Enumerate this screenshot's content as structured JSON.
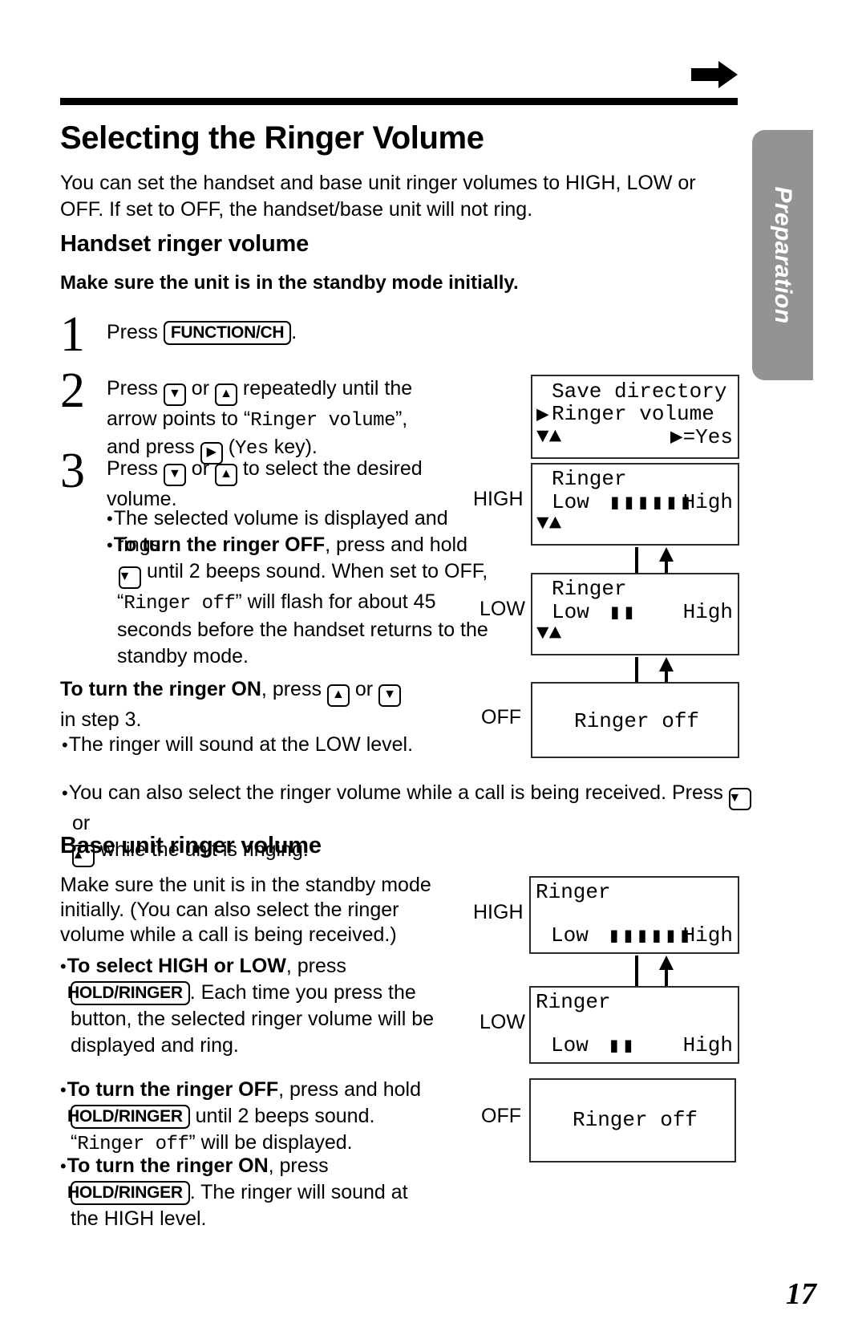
{
  "page": {
    "number": "17",
    "side_tab": "Preparation"
  },
  "header": {
    "arrow_icon": "right-arrow-icon"
  },
  "title": "Selecting the Ringer Volume",
  "intro": "You can set the handset and base unit ringer volumes to HIGH, LOW or OFF. If set to OFF, the handset/base unit will not ring.",
  "handset": {
    "heading": "Handset ringer volume",
    "precondition": "Make sure the unit is in the standby mode initially.",
    "steps": [
      {
        "num": "1",
        "pre": "Press ",
        "key": "FUNCTION/CH",
        "post": "."
      },
      {
        "num": "2",
        "l1a": "Press ",
        "k_down": "▼",
        "l1b": " or ",
        "k_up": "▲",
        "l1c": " repeatedly until the",
        "l2a": "arrow points to “",
        "l2_mono": "Ringer volume",
        "l2b": "”,",
        "l3a": "and press ",
        "k_right": "▶",
        "l3b": " (",
        "l3_mono": "Yes",
        "l3c": " key)."
      },
      {
        "num": "3",
        "l1a": "Press ",
        "k_down": "▼",
        "l1b": " or ",
        "k_up": "▲",
        "l1c": " to select the desired",
        "l2": "volume."
      }
    ],
    "bullets": [
      {
        "text": "The selected volume is displayed and rings."
      },
      {
        "bold": "To turn the ringer OFF",
        "rest1": ", press and hold",
        "key": "▼",
        "rest2": " until 2 beeps sound. When set to OFF,",
        "quote_open": "“",
        "mono": "Ringer off",
        "quote_close": "”",
        "rest3": " will flash for about 45",
        "rest4": "seconds before the handset returns to the",
        "rest5": "standby mode."
      }
    ],
    "turn_on": {
      "bold": "To turn the ringer ON",
      "mid": ", press ",
      "k_up": "▲",
      "mid2": " or ",
      "k_down": "▼",
      "line2": "in step 3.",
      "bullet": "The ringer will sound at the LOW level."
    },
    "call_note": {
      "l1a": "You can also select the ringer volume while a call is being received. Press ",
      "k_down": "▼",
      "l1b": " or",
      "k_up": "▲",
      "l2": " while the unit is ringing."
    },
    "lcds": [
      {
        "name": "menu-lcd",
        "line1": "Save directory",
        "line2_marker": "▶",
        "line2": "Ringer volume",
        "line3_left": "▼▲",
        "line3_right": "▶=Yes"
      },
      {
        "name": "high-lcd",
        "level": "HIGH",
        "line1": "Ringer",
        "low": "Low",
        "blocks": 6,
        "high": "High",
        "line3_left": "▼▲"
      },
      {
        "name": "low-lcd",
        "level": "LOW",
        "line1": "Ringer",
        "low": "Low",
        "blocks": 2,
        "high": "High",
        "line3_left": "▼▲"
      },
      {
        "name": "off-lcd",
        "level": "OFF",
        "text": "Ringer off"
      }
    ]
  },
  "base": {
    "heading": "Base unit ringer volume",
    "intro": "Make sure the unit is in the standby mode initially. (You can also select the ringer volume while a call is being received.)",
    "bullets": [
      {
        "bold": "To select HIGH or LOW",
        "rest1": ", press",
        "key": "HOLD/RINGER",
        "rest2": ". Each time you press the",
        "rest3": "button, the selected ringer volume will be",
        "rest4": "displayed and ring."
      },
      {
        "bold": "To turn the ringer OFF",
        "rest1": ", press and hold",
        "key": "HOLD/RINGER",
        "rest2": " until 2 beeps sound.",
        "quote_open": "“",
        "mono": "Ringer off",
        "quote_close": "”",
        "rest3": " will be displayed."
      },
      {
        "bold": "To turn the ringer ON",
        "rest1": ", press",
        "key": "HOLD/RINGER",
        "rest2": ". The ringer will sound at",
        "rest3": "the HIGH level."
      }
    ],
    "lcds": [
      {
        "name": "base-high-lcd",
        "level": "HIGH",
        "line1": "Ringer",
        "low": "Low",
        "blocks": 6,
        "high": "High"
      },
      {
        "name": "base-low-lcd",
        "level": "LOW",
        "line1": "Ringer",
        "low": "Low",
        "blocks": 2,
        "high": "High"
      },
      {
        "name": "base-off-lcd",
        "level": "OFF",
        "text": "Ringer off"
      }
    ]
  },
  "colors": {
    "tab_gray": "#939393",
    "ink": "#000000"
  }
}
